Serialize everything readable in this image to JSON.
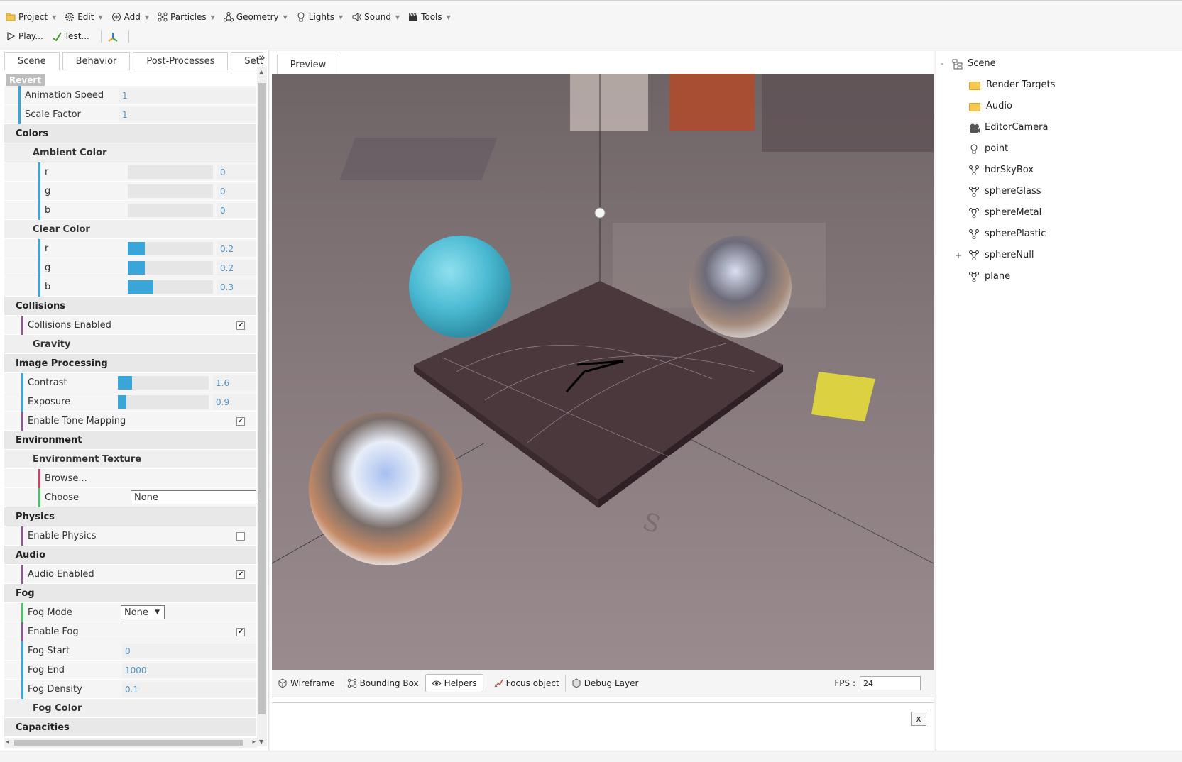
{
  "toolbar": {
    "menus": [
      {
        "label": "Project",
        "icon": "folder-icon"
      },
      {
        "label": "Edit",
        "icon": "gear-icon"
      },
      {
        "label": "Add",
        "icon": "plus-circle-icon"
      },
      {
        "label": "Particles",
        "icon": "particles-icon"
      },
      {
        "label": "Geometry",
        "icon": "geometry-icon"
      },
      {
        "label": "Lights",
        "icon": "lightbulb-icon"
      },
      {
        "label": "Sound",
        "icon": "speaker-icon"
      },
      {
        "label": "Tools",
        "icon": "clapperboard-icon"
      }
    ],
    "play_label": "Play...",
    "test_label": "Test..."
  },
  "left_panel": {
    "tabs": [
      "Scene",
      "Behavior",
      "Post-Processes",
      "Sett"
    ],
    "collapse_icon": "»",
    "revert_label": "Revert",
    "animation_speed_label": "Animation Speed",
    "animation_speed_value": "1",
    "scale_factor_label": "Scale Factor",
    "scale_factor_value": "1",
    "colors_label": "Colors",
    "ambient_color_label": "Ambient Color",
    "ambient": {
      "r_label": "r",
      "r": "0",
      "g_label": "g",
      "g": "0",
      "b_label": "b",
      "b": "0"
    },
    "clear_color_label": "Clear Color",
    "clear": {
      "r_label": "r",
      "r": "0.2",
      "g_label": "g",
      "g": "0.2",
      "b_label": "b",
      "b": "0.3"
    },
    "collisions_label": "Collisions",
    "collisions_enabled_label": "Collisions Enabled",
    "gravity_label": "Gravity",
    "image_processing_label": "Image Processing",
    "contrast_label": "Contrast",
    "contrast_value": "1.6",
    "exposure_label": "Exposure",
    "exposure_value": "0.9",
    "tone_mapping_label": "Enable Tone Mapping",
    "environment_label": "Environment",
    "environment_texture_label": "Environment Texture",
    "browse_label": "Browse...",
    "choose_label": "Choose",
    "choose_value": "None",
    "physics_label": "Physics",
    "enable_physics_label": "Enable Physics",
    "audio_label": "Audio",
    "audio_enabled_label": "Audio Enabled",
    "fog_label": "Fog",
    "fog_mode_label": "Fog Mode",
    "fog_mode_value": "None",
    "enable_fog_label": "Enable Fog",
    "fog_start_label": "Fog Start",
    "fog_start_value": "0",
    "fog_end_label": "Fog End",
    "fog_end_value": "1000",
    "fog_density_label": "Fog Density",
    "fog_density_value": "0.1",
    "fog_color_label": "Fog Color",
    "capacities_label": "Capacities",
    "checked": {
      "collisions": true,
      "tone_mapping": true,
      "physics": false,
      "audio": true,
      "fog": true
    },
    "sliders": {
      "clear_r": 0.2,
      "clear_g": 0.2,
      "clear_b": 0.3,
      "contrast": 0.16,
      "exposure": 0.09
    }
  },
  "center": {
    "preview_tab": "Preview",
    "bottom_buttons": [
      {
        "label": "Wireframe",
        "icon": "cube-icon"
      },
      {
        "label": "Bounding Box",
        "icon": "bounding-box-icon"
      },
      {
        "label": "Helpers",
        "icon": "eye-icon"
      },
      {
        "label": "Focus object",
        "icon": "focus-icon"
      },
      {
        "label": "Debug Layer",
        "icon": "debug-layer-icon"
      }
    ],
    "fps_label": "FPS :",
    "fps_value": "24",
    "close_label": "x"
  },
  "scene_tree": {
    "root_toggle": "-",
    "root": "Scene",
    "items": [
      {
        "label": "Render Targets",
        "icon": "folder-icon"
      },
      {
        "label": "Audio",
        "icon": "folder-icon"
      },
      {
        "label": "EditorCamera",
        "icon": "camera-icon"
      },
      {
        "label": "point",
        "icon": "lightbulb-icon"
      },
      {
        "label": "hdrSkyBox",
        "icon": "mesh-icon"
      },
      {
        "label": "sphereGlass",
        "icon": "mesh-icon"
      },
      {
        "label": "sphereMetal",
        "icon": "mesh-icon"
      },
      {
        "label": "spherePlastic",
        "icon": "mesh-icon"
      },
      {
        "label": "sphereNull",
        "icon": "mesh-icon",
        "expand": "+"
      },
      {
        "label": "plane",
        "icon": "mesh-icon"
      }
    ]
  },
  "colors": {
    "accent": "#3aa5d9",
    "bar_blue": "#3aa5d9",
    "bar_green": "#4fbf6a",
    "bar_pink": "#c2456a"
  }
}
